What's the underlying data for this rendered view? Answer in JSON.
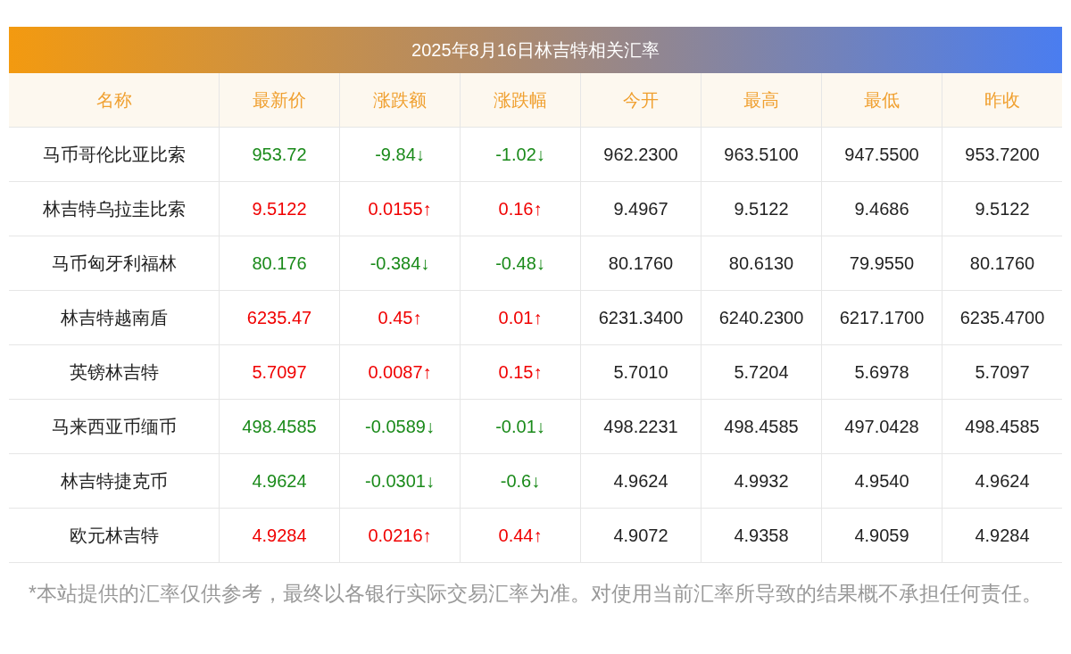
{
  "title": "2025年8月16日林吉特相关汇率",
  "columns": [
    "名称",
    "最新价",
    "涨跌额",
    "涨跌幅",
    "今开",
    "最高",
    "最低",
    "昨收"
  ],
  "rows": [
    {
      "name": "马币哥伦比亚比索",
      "rising": false,
      "latest": "953.72",
      "change": "-9.84↓",
      "pct": "-1.02↓",
      "open": "962.2300",
      "high": "963.5100",
      "low": "947.5500",
      "prev": "953.7200"
    },
    {
      "name": "林吉特乌拉圭比索",
      "rising": true,
      "latest": "9.5122",
      "change": "0.0155↑",
      "pct": "0.16↑",
      "open": "9.4967",
      "high": "9.5122",
      "low": "9.4686",
      "prev": "9.5122"
    },
    {
      "name": "马币匈牙利福林",
      "rising": false,
      "latest": "80.176",
      "change": "-0.384↓",
      "pct": "-0.48↓",
      "open": "80.1760",
      "high": "80.6130",
      "low": "79.9550",
      "prev": "80.1760"
    },
    {
      "name": "林吉特越南盾",
      "rising": true,
      "latest": "6235.47",
      "change": "0.45↑",
      "pct": "0.01↑",
      "open": "6231.3400",
      "high": "6240.2300",
      "low": "6217.1700",
      "prev": "6235.4700"
    },
    {
      "name": "英镑林吉特",
      "rising": true,
      "latest": "5.7097",
      "change": "0.0087↑",
      "pct": "0.15↑",
      "open": "5.7010",
      "high": "5.7204",
      "low": "5.6978",
      "prev": "5.7097"
    },
    {
      "name": "马来西亚币缅币",
      "rising": false,
      "latest": "498.4585",
      "change": "-0.0589↓",
      "pct": "-0.01↓",
      "open": "498.2231",
      "high": "498.4585",
      "low": "497.0428",
      "prev": "498.4585"
    },
    {
      "name": "林吉特捷克币",
      "rising": false,
      "latest": "4.9624",
      "change": "-0.0301↓",
      "pct": "-0.6↓",
      "open": "4.9624",
      "high": "4.9932",
      "low": "4.9540",
      "prev": "4.9624"
    },
    {
      "name": "欧元林吉特",
      "rising": true,
      "latest": "4.9284",
      "change": "0.0216↑",
      "pct": "0.44↑",
      "open": "4.9072",
      "high": "4.9358",
      "low": "4.9059",
      "prev": "4.9284"
    }
  ],
  "footnote": "*本站提供的汇率仅供参考，最终以各银行实际交易汇率为准。对使用当前汇率所导致的结果概不承担任何责任。"
}
